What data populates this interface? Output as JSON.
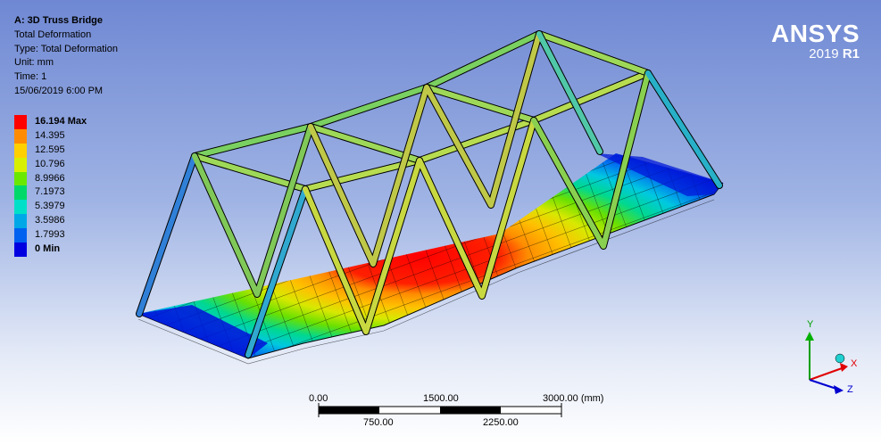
{
  "info": {
    "title": "A: 3D Truss Bridge",
    "line1": "Total Deformation",
    "line2": "Type: Total Deformation",
    "line3": "Unit: mm",
    "line4": "Time: 1",
    "line5": "15/06/2019 6:00 PM"
  },
  "legend": [
    {
      "label": "16.194 Max",
      "color": "#ff0000",
      "bold": true
    },
    {
      "label": "14.395",
      "color": "#ff8c00"
    },
    {
      "label": "12.595",
      "color": "#ffd000"
    },
    {
      "label": "10.796",
      "color": "#d8f000"
    },
    {
      "label": "8.9966",
      "color": "#6ae800"
    },
    {
      "label": "7.1973",
      "color": "#00d86a"
    },
    {
      "label": "5.3979",
      "color": "#00e0c8"
    },
    {
      "label": "3.5986",
      "color": "#00a8e8"
    },
    {
      "label": "1.7993",
      "color": "#0060f0"
    },
    {
      "label": "0 Min",
      "color": "#0000e0",
      "bold": true
    }
  ],
  "logo": {
    "brand": "ANSYS",
    "version": "2019",
    "release": "R1"
  },
  "scale": {
    "top_labels": [
      "0.00",
      "1500.00",
      "3000.00 (mm)"
    ],
    "bottom_labels": [
      "750.00",
      "2250.00"
    ]
  },
  "triad": {
    "x": "X",
    "y": "Y",
    "z": "Z"
  }
}
